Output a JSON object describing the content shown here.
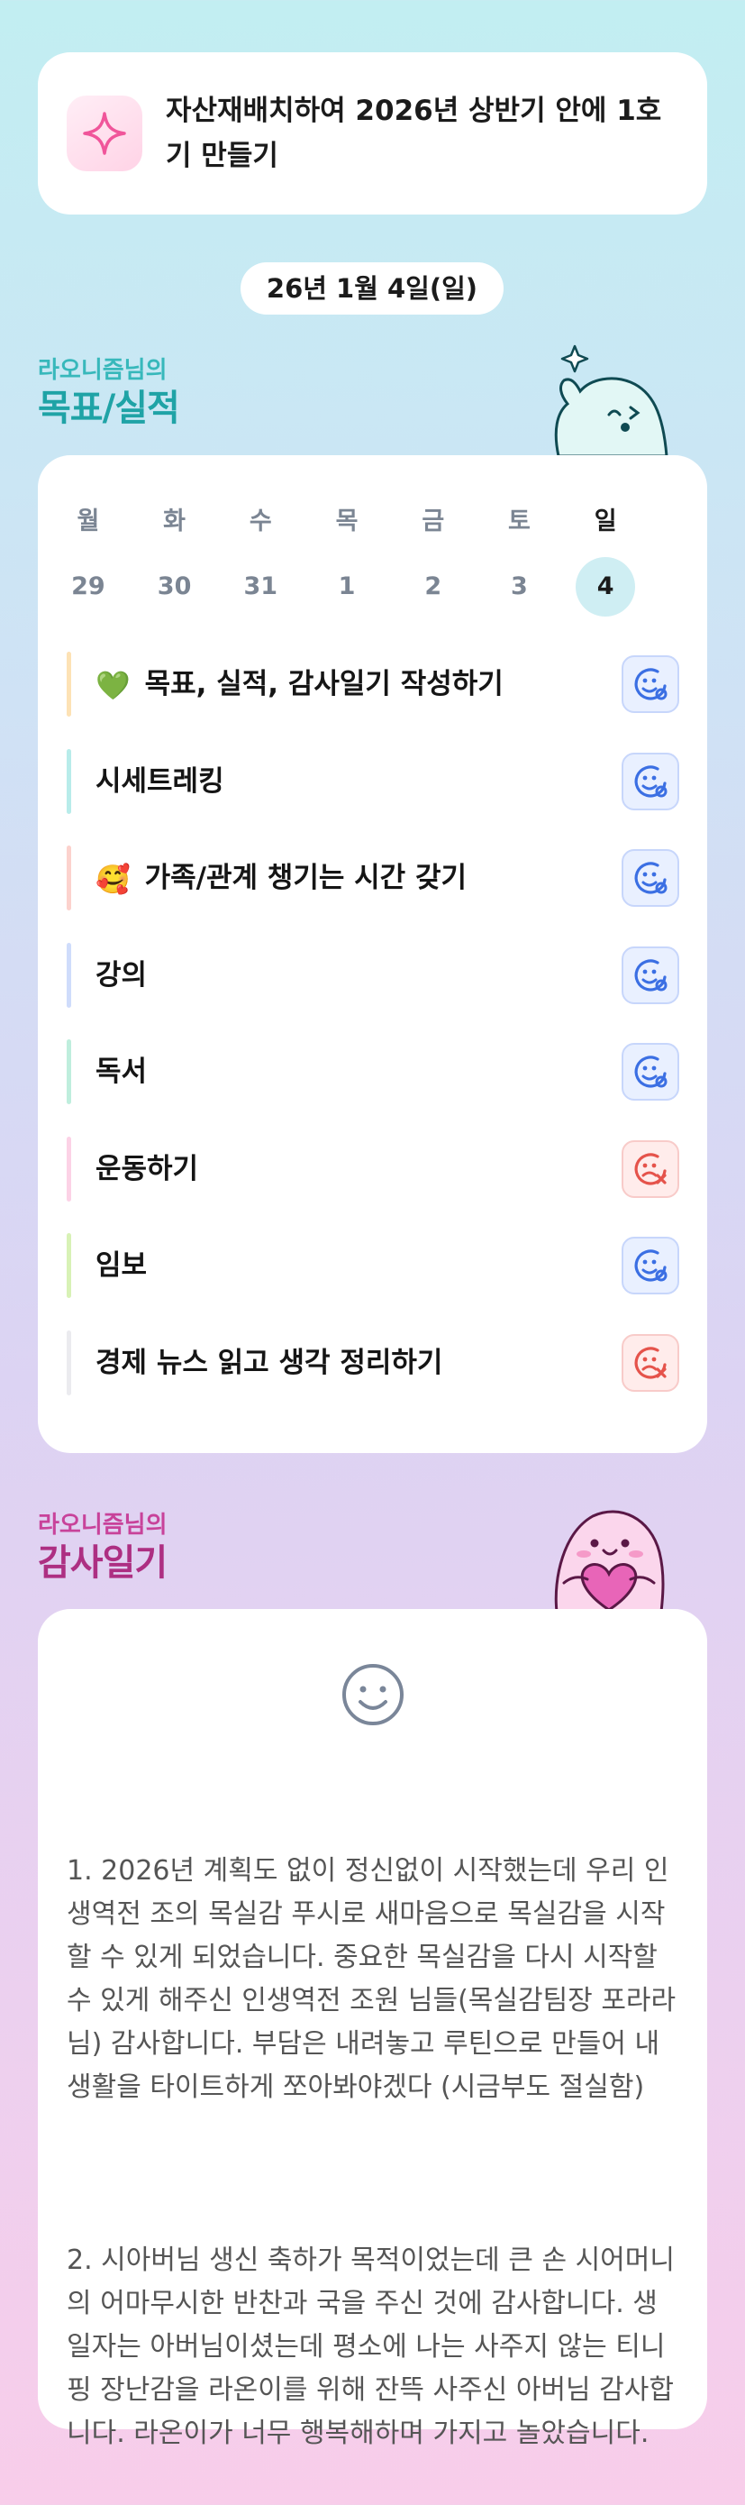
{
  "goal": {
    "icon": "sparkle-icon",
    "text": "자산재배치하여 2026년 상반기 안에 1호기 만들기"
  },
  "date_label": "26년 1월 4일(일)",
  "section_goals": {
    "small": "라오니즘님의",
    "big": "목표/실적"
  },
  "calendar": {
    "weekdays": [
      "월",
      "화",
      "수",
      "목",
      "금",
      "토",
      "일"
    ],
    "days": [
      "29",
      "30",
      "31",
      "1",
      "2",
      "3",
      "4"
    ],
    "selected_index": 6
  },
  "goals": [
    {
      "emoji": "💚",
      "label": "목표, 실적, 감사일기 작성하기",
      "bar_color": "#fde2b5",
      "status": "done"
    },
    {
      "emoji": "",
      "label": "시세트레킹",
      "bar_color": "#b8ecea",
      "status": "done"
    },
    {
      "emoji": "🥰",
      "label": "가족/관계 챙기는 시간 갖기",
      "bar_color": "#fcd2cd",
      "status": "done"
    },
    {
      "emoji": "",
      "label": "강의",
      "bar_color": "#cfdcfb",
      "status": "done"
    },
    {
      "emoji": "",
      "label": "독서",
      "bar_color": "#bfeedd",
      "status": "done"
    },
    {
      "emoji": "",
      "label": "운동하기",
      "bar_color": "#fcd2e6",
      "status": "missed"
    },
    {
      "emoji": "",
      "label": "임보",
      "bar_color": "#d8f2b6",
      "status": "done"
    },
    {
      "emoji": "",
      "label": "경제 뉴스 읽고 생각 정리하기",
      "bar_color": "#ebebef",
      "status": "missed"
    }
  ],
  "section_gratitude": {
    "small": "라오니즘님의",
    "big": "감사일기"
  },
  "gratitude": {
    "mood_icon": "smile-face-icon",
    "entries": [
      "1. 2026년 계획도 없이 정신없이 시작했는데 우리 인생역전 조의 목실감 푸시로 새마음으로 목실감을 시작할 수 있게 되었습니다. 중요한 목실감을 다시 시작할 수 있게 해주신 인생역전 조원 님들(목실감팀장 포라라님) 감사합니다. 부담은 내려놓고 루틴으로 만들어 내 생활을 타이트하게 쪼아봐야겠다 (시금부도 절실함)",
      "2. 시아버님 생신 축하가 목적이었는데 큰 손 시어머니의 어마무시한 반찬과 국을 주신 것에 감사합니다. 생일자는 아버님이셨는데 평소에 나는 사주지 않는 티니핑 장난감을 라온이를 위해 잔뜩 사주신 아버님 감사합니다. 라온이가 너무 행복해하며 가지고 놀았습니다."
    ]
  },
  "colors": {
    "teal_title": "#1fa3a6",
    "pink_title": "#ad2f82",
    "status_done": "#3b6fe3",
    "status_missed": "#e5534b"
  }
}
